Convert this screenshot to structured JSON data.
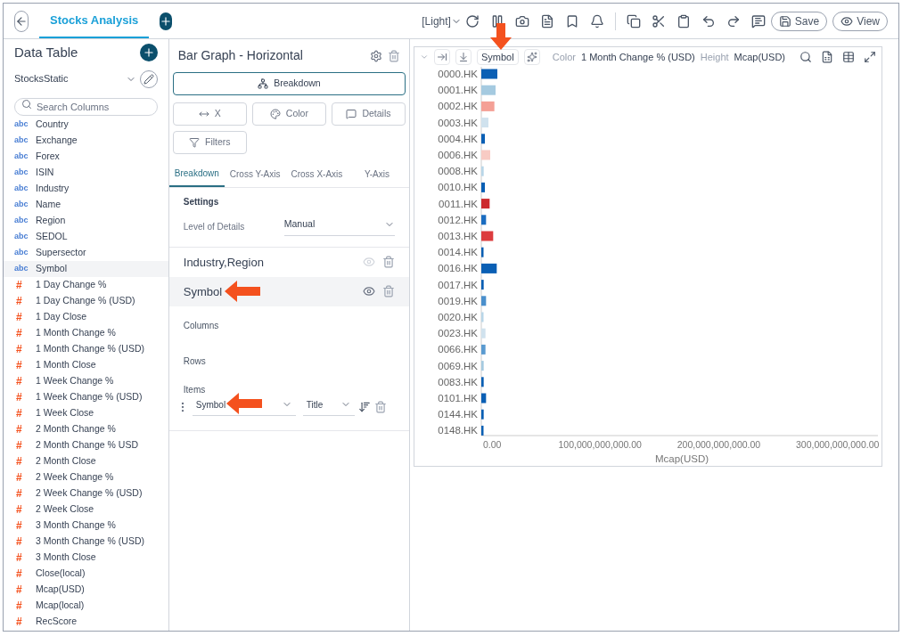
{
  "toolbar": {
    "tabs": [
      {
        "label": "Stocks Analysis",
        "selected": true
      }
    ],
    "theme": "[Light]",
    "buttons": [
      {
        "label": "Save",
        "kind": "save"
      },
      {
        "label": "View",
        "kind": "view"
      }
    ]
  },
  "data_panel": {
    "title": "Data Table",
    "source": "StocksStatic",
    "search": {
      "placeholder": "Search Columns"
    },
    "columns": [
      {
        "name": "Country",
        "kind": "text",
        "tag": "abc",
        "selected": false
      },
      {
        "name": "Exchange",
        "kind": "text",
        "tag": "abc",
        "selected": false
      },
      {
        "name": "Forex",
        "kind": "text",
        "tag": "abc",
        "selected": false
      },
      {
        "name": "ISIN",
        "kind": "text",
        "tag": "abc",
        "selected": false
      },
      {
        "name": "Industry",
        "kind": "text",
        "tag": "abc",
        "selected": false
      },
      {
        "name": "Name",
        "kind": "text",
        "tag": "abc",
        "selected": false
      },
      {
        "name": "Region",
        "kind": "text",
        "tag": "abc",
        "selected": false
      },
      {
        "name": "SEDOL",
        "kind": "text",
        "tag": "abc",
        "selected": false
      },
      {
        "name": "Supersector",
        "kind": "text",
        "tag": "abc",
        "selected": false
      },
      {
        "name": "Symbol",
        "kind": "text",
        "tag": "abc",
        "selected": true
      },
      {
        "name": "1 Day Change %",
        "kind": "number",
        "tag": "#",
        "selected": false
      },
      {
        "name": "1 Day Change % (USD)",
        "kind": "number",
        "tag": "#",
        "selected": false
      },
      {
        "name": "1 Day Close",
        "kind": "number",
        "tag": "#",
        "selected": false
      },
      {
        "name": "1 Month Change %",
        "kind": "number",
        "tag": "#",
        "selected": false
      },
      {
        "name": "1 Month Change % (USD)",
        "kind": "number",
        "tag": "#",
        "selected": false
      },
      {
        "name": "1 Month Close",
        "kind": "number",
        "tag": "#",
        "selected": false
      },
      {
        "name": "1 Week Change %",
        "kind": "number",
        "tag": "#",
        "selected": false
      },
      {
        "name": "1 Week Change % (USD)",
        "kind": "number",
        "tag": "#",
        "selected": false
      },
      {
        "name": "1 Week Close",
        "kind": "number",
        "tag": "#",
        "selected": false
      },
      {
        "name": "2 Month Change %",
        "kind": "number",
        "tag": "#",
        "selected": false
      },
      {
        "name": "2 Month Change % USD",
        "kind": "number",
        "tag": "#",
        "selected": false
      },
      {
        "name": "2 Month Close",
        "kind": "number",
        "tag": "#",
        "selected": false
      },
      {
        "name": "2 Week Change %",
        "kind": "number",
        "tag": "#",
        "selected": false
      },
      {
        "name": "2 Week Change % (USD)",
        "kind": "number",
        "tag": "#",
        "selected": false
      },
      {
        "name": "2 Week Close",
        "kind": "number",
        "tag": "#",
        "selected": false
      },
      {
        "name": "3 Month Change %",
        "kind": "number",
        "tag": "#",
        "selected": false
      },
      {
        "name": "3 Month Change % (USD)",
        "kind": "number",
        "tag": "#",
        "selected": false
      },
      {
        "name": "3 Month Close",
        "kind": "number",
        "tag": "#",
        "selected": false
      },
      {
        "name": "Close(local)",
        "kind": "number",
        "tag": "#",
        "selected": false
      },
      {
        "name": "Mcap(USD)",
        "kind": "number",
        "tag": "#",
        "selected": false
      },
      {
        "name": "Mcap(local)",
        "kind": "number",
        "tag": "#",
        "selected": false
      },
      {
        "name": "RecScore",
        "kind": "number",
        "tag": "#",
        "selected": false
      }
    ]
  },
  "settings_panel": {
    "title": "Bar Graph - Horizontal",
    "main_variable": {
      "label": "Breakdown",
      "selected": true
    },
    "variables": [
      {
        "label": "X",
        "kind": "x"
      },
      {
        "label": "Color",
        "kind": "color"
      },
      {
        "label": "Details",
        "kind": "details"
      },
      {
        "label": "Filters",
        "kind": "filters"
      }
    ],
    "tabs": [
      {
        "label": "Breakdown",
        "selected": true
      },
      {
        "label": "Cross Y-Axis",
        "selected": false
      },
      {
        "label": "Cross X-Axis",
        "selected": false
      },
      {
        "label": "Y-Axis",
        "selected": false
      }
    ],
    "settings_heading": "Settings",
    "level_of_details": {
      "label": "Level of Details",
      "value": "Manual"
    },
    "breakdown_levels": [
      {
        "label": "Industry,Region",
        "selected": false
      },
      {
        "label": "Symbol",
        "selected": true
      }
    ],
    "sections": [
      "Columns",
      "Rows"
    ],
    "items": {
      "label": "Items",
      "column": "Symbol",
      "format": "Title"
    }
  },
  "chart_panel": {
    "breakdown": "Symbol",
    "color_label": "Color",
    "color_value": "1 Month Change % (USD)",
    "height_label": "Height",
    "height_value": "Mcap(USD)",
    "chart_data": {
      "type": "bar",
      "orientation": "horizontal",
      "xlabel": "Mcap(USD)",
      "xlim": [
        0,
        334000000000
      ],
      "xticks": [
        {
          "value": 0,
          "label": "0.00"
        },
        {
          "value": 100000000000,
          "label": "100,000,000,000.00"
        },
        {
          "value": 200000000000,
          "label": "200,000,000,000.00"
        },
        {
          "value": 300000000000,
          "label": "300,000,000,000.00"
        }
      ],
      "categories": [
        "0000.HK",
        "0001.HK",
        "0002.HK",
        "0003.HK",
        "0004.HK",
        "0006.HK",
        "0008.HK",
        "0010.HK",
        "0011.HK",
        "0012.HK",
        "0013.HK",
        "0014.HK",
        "0016.HK",
        "0017.HK",
        "0019.HK",
        "0020.HK",
        "0023.HK",
        "0066.HK",
        "0069.HK",
        "0083.HK",
        "0101.HK",
        "0144.HK",
        "0148.HK"
      ],
      "series": [
        {
          "values": [
            13500000000,
            12000000000,
            11000000000,
            6000000000,
            3000000000,
            7500000000,
            2000000000,
            3000000000,
            7000000000,
            4000000000,
            10000000000,
            700000000,
            13000000000,
            2000000000,
            4000000000,
            1500000000,
            3500000000,
            3500000000,
            2000000000,
            2000000000,
            4000000000,
            2000000000,
            1500000000
          ],
          "colors": [
            "#0a5fb4",
            "#a5cae0",
            "#f4a096",
            "#d0e2ee",
            "#0a5fb4",
            "#f8cbc4",
            "#b8d6e8",
            "#0a5fb4",
            "#cc2a2e",
            "#1a6cc0",
            "#dc3c3e",
            "#0a5fb4",
            "#0a5fb4",
            "#0a5fb4",
            "#4a8fcc",
            "#b8d6e8",
            "#d0e2ee",
            "#5a9ad0",
            "#a5cae0",
            "#0a5fb4",
            "#0a5fb4",
            "#0a5fb4",
            "#0a5fb4"
          ]
        }
      ]
    }
  }
}
